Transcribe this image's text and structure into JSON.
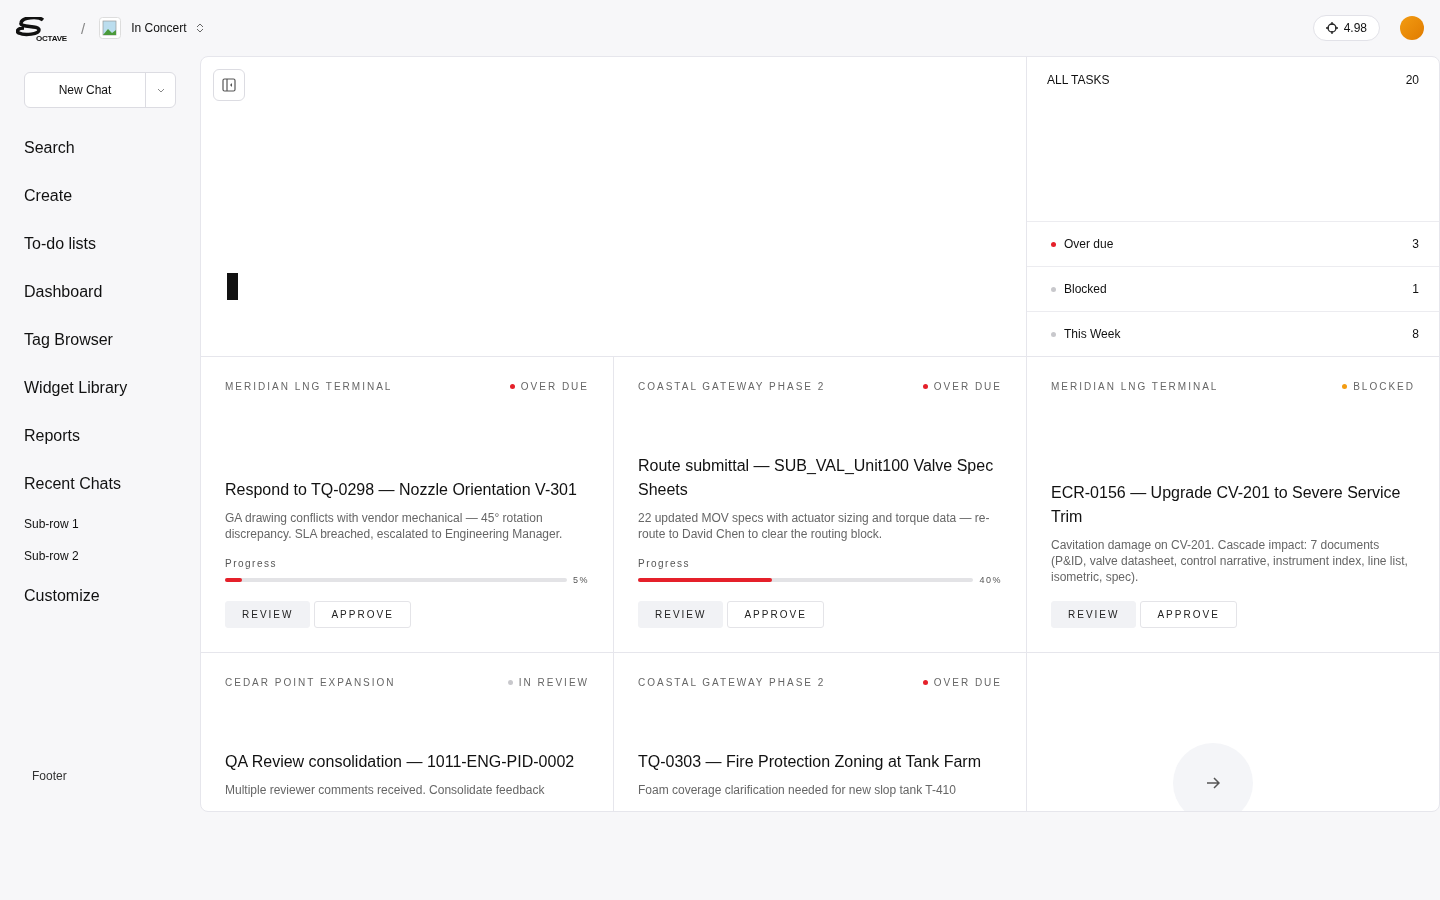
{
  "header": {
    "logo_text": "OCTAVE",
    "separator": "/",
    "workspace": "In Concert",
    "credits": "4.98"
  },
  "sidebar": {
    "new_chat": "New Chat",
    "items": [
      "Search",
      "Create",
      "To-do lists",
      "Dashboard",
      "Tag Browser",
      "Widget Library",
      "Reports"
    ],
    "recent": {
      "label": "Recent Chats",
      "children": [
        "Sub-row 1",
        "Sub-row 2"
      ]
    },
    "customize": "Customize",
    "footer": "Footer"
  },
  "tasks": {
    "title": "ALL TASKS",
    "total": "20",
    "rows": [
      {
        "label": "Over due",
        "count": "3",
        "color": "#e5202a"
      },
      {
        "label": "Blocked",
        "count": "1",
        "color": "#c8c8cc"
      },
      {
        "label": "This Week",
        "count": "8",
        "color": "#c8c8cc"
      }
    ]
  },
  "cards": [
    {
      "project": "MERIDIAN LNG TERMINAL",
      "status": "OVER DUE",
      "color": "#e5202a",
      "title": "Respond to TQ-0298 — Nozzle Orientation V-301",
      "description": "GA drawing conflicts with vendor mechanical — 45° rotation discrepancy. SLA breached, escalated to Engineering Manager.",
      "progress": {
        "label": "Progress",
        "level": 0.05,
        "reading": "5%"
      },
      "actions": [
        "REVIEW",
        "APPROVE"
      ]
    },
    {
      "project": "COASTAL GATEWAY PHASE 2",
      "status": "OVER DUE",
      "color": "#e5202a",
      "title": "Route submittal — SUB_VAL_Unit100 Valve Spec Sheets",
      "description": "22 updated MOV specs with actuator sizing and torque data — re-route to David Chen to clear the routing block.",
      "progress": {
        "label": "Progress",
        "level": 0.4,
        "reading": "40%"
      },
      "actions": [
        "REVIEW",
        "APPROVE"
      ]
    },
    {
      "project": "MERIDIAN LNG TERMINAL",
      "status": "BLOCKED",
      "color": "#f39c12",
      "title": "ECR-0156 — Upgrade CV-201 to Severe Service Trim",
      "description": "Cavitation damage on CV-201. Cascade impact: 7 documents (P&ID, valve datasheet, control narrative, instrument index, line list, isometric, spec).",
      "actions": [
        "REVIEW",
        "APPROVE"
      ]
    },
    {
      "project": "CEDAR POINT EXPANSION",
      "status": "IN REVIEW",
      "color": "#c8c8cc",
      "title": "QA Review consolidation — 1011-ENG-PID-0002",
      "description": "Multiple reviewer comments received. Consolidate feedback"
    },
    {
      "project": "COASTAL GATEWAY PHASE 2",
      "status": "OVER DUE",
      "color": "#e5202a",
      "title": "TQ-0303 — Fire Protection Zoning at Tank Farm",
      "description": "Foam coverage clarification needed for new slop tank T-410"
    }
  ]
}
